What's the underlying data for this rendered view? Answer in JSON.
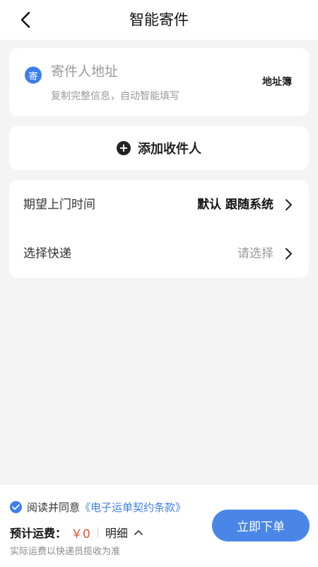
{
  "header": {
    "title": "智能寄件"
  },
  "sender": {
    "badge": "寄",
    "title": "寄件人地址",
    "subtitle": "复制完整信息，自动智能填写",
    "address_book": "地址簿"
  },
  "receiver": {
    "add_label": "添加收件人"
  },
  "options": {
    "pickup_time": {
      "label": "期望上门时间",
      "value": "默认 跟随系统"
    },
    "express": {
      "label": "选择快递",
      "value": "请选择"
    }
  },
  "footer": {
    "agree_text": "阅读并同意",
    "agreement_link": "《电子运单契约条款》",
    "fee_label": "预计运费：",
    "fee_value": "￥0",
    "detail_label": "明细",
    "note": "实际运费以快递员揽收为准",
    "submit_label": "立即下单"
  },
  "colors": {
    "accent": "#3f7fea",
    "price": "#e4572e",
    "background": "#f4f4f4"
  },
  "icons": {
    "back": "chevron-left-icon",
    "add": "plus-circle-icon",
    "arrow": "chevron-right-icon",
    "check": "checkmark-circle-icon",
    "caret": "chevron-up-icon"
  }
}
